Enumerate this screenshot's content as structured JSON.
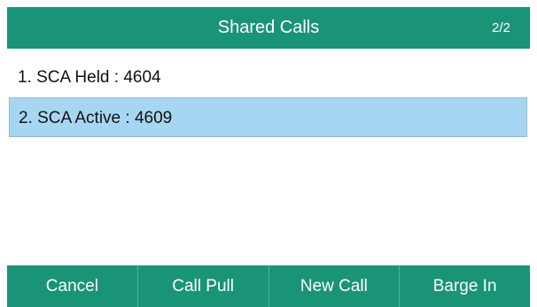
{
  "header": {
    "title": "Shared Calls",
    "page_indicator": "2/2"
  },
  "calls": [
    {
      "label": "1. SCA Held : 4604",
      "selected": false
    },
    {
      "label": "2. SCA Active : 4609",
      "selected": true
    }
  ],
  "softkeys": [
    {
      "label": "Cancel"
    },
    {
      "label": "Call Pull"
    },
    {
      "label": "New Call"
    },
    {
      "label": "Barge In"
    }
  ],
  "colors": {
    "bar_background": "#1a9476",
    "selection_highlight": "#a7d6f3",
    "bar_text": "#ffffff"
  }
}
